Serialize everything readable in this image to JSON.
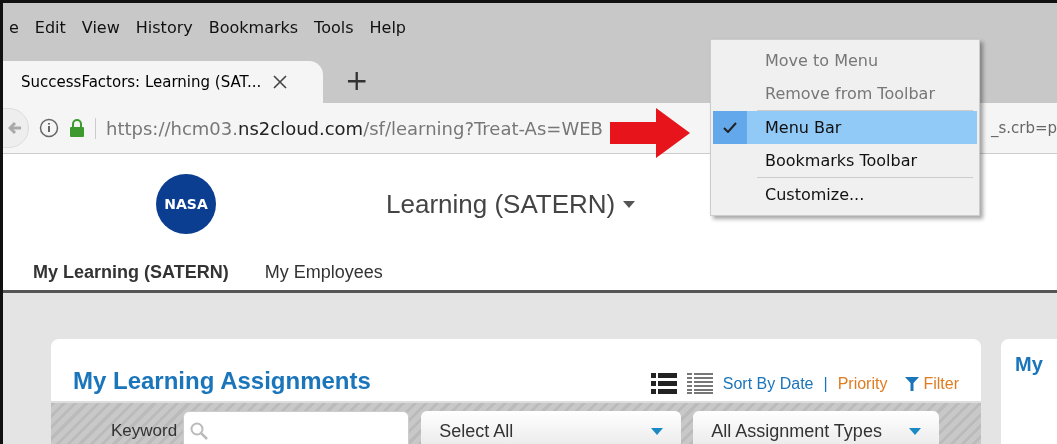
{
  "menu_bar": [
    "e",
    "Edit",
    "View",
    "History",
    "Bookmarks",
    "Tools",
    "Help"
  ],
  "tabs": [
    {
      "label": "SuccessFactors: Learning (SAT...",
      "selected": true
    }
  ],
  "new_tab": "+",
  "address_bar": {
    "prefix": "https://hcm03.",
    "domain": "ns2cloud.com",
    "path": "/sf/learning?Treat-As=WEB",
    "tail": "_s.crb=p"
  },
  "context_menu": [
    {
      "label": "Move to Menu",
      "disabled": true,
      "checked": false,
      "selected": false,
      "separator_after": false
    },
    {
      "label": "Remove from Toolbar",
      "disabled": true,
      "checked": false,
      "selected": false,
      "separator_after": true
    },
    {
      "label": "Menu Bar",
      "disabled": false,
      "checked": true,
      "selected": true,
      "separator_after": false
    },
    {
      "label": "Bookmarks Toolbar",
      "disabled": false,
      "checked": false,
      "selected": false,
      "separator_after": true
    },
    {
      "label": "Customize...",
      "disabled": false,
      "checked": false,
      "selected": false,
      "separator_after": false
    }
  ],
  "logo_text": "NASA",
  "app_title": "Learning (SATERN)",
  "nav": [
    {
      "label": "My Learning (SATERN)",
      "selected": true
    },
    {
      "label": "My Employees",
      "selected": false
    }
  ],
  "card": {
    "title": "My Learning Assignments",
    "sort_separator": "|",
    "sort": [
      {
        "label": "Sort By Date",
        "selected": false
      },
      {
        "label": "Priority",
        "selected": true
      }
    ],
    "filter": "Filter",
    "keyword_label": "Keyword",
    "dropdowns": [
      "Select All",
      "All Assignment Types"
    ]
  },
  "side_card": {
    "title": "My"
  }
}
